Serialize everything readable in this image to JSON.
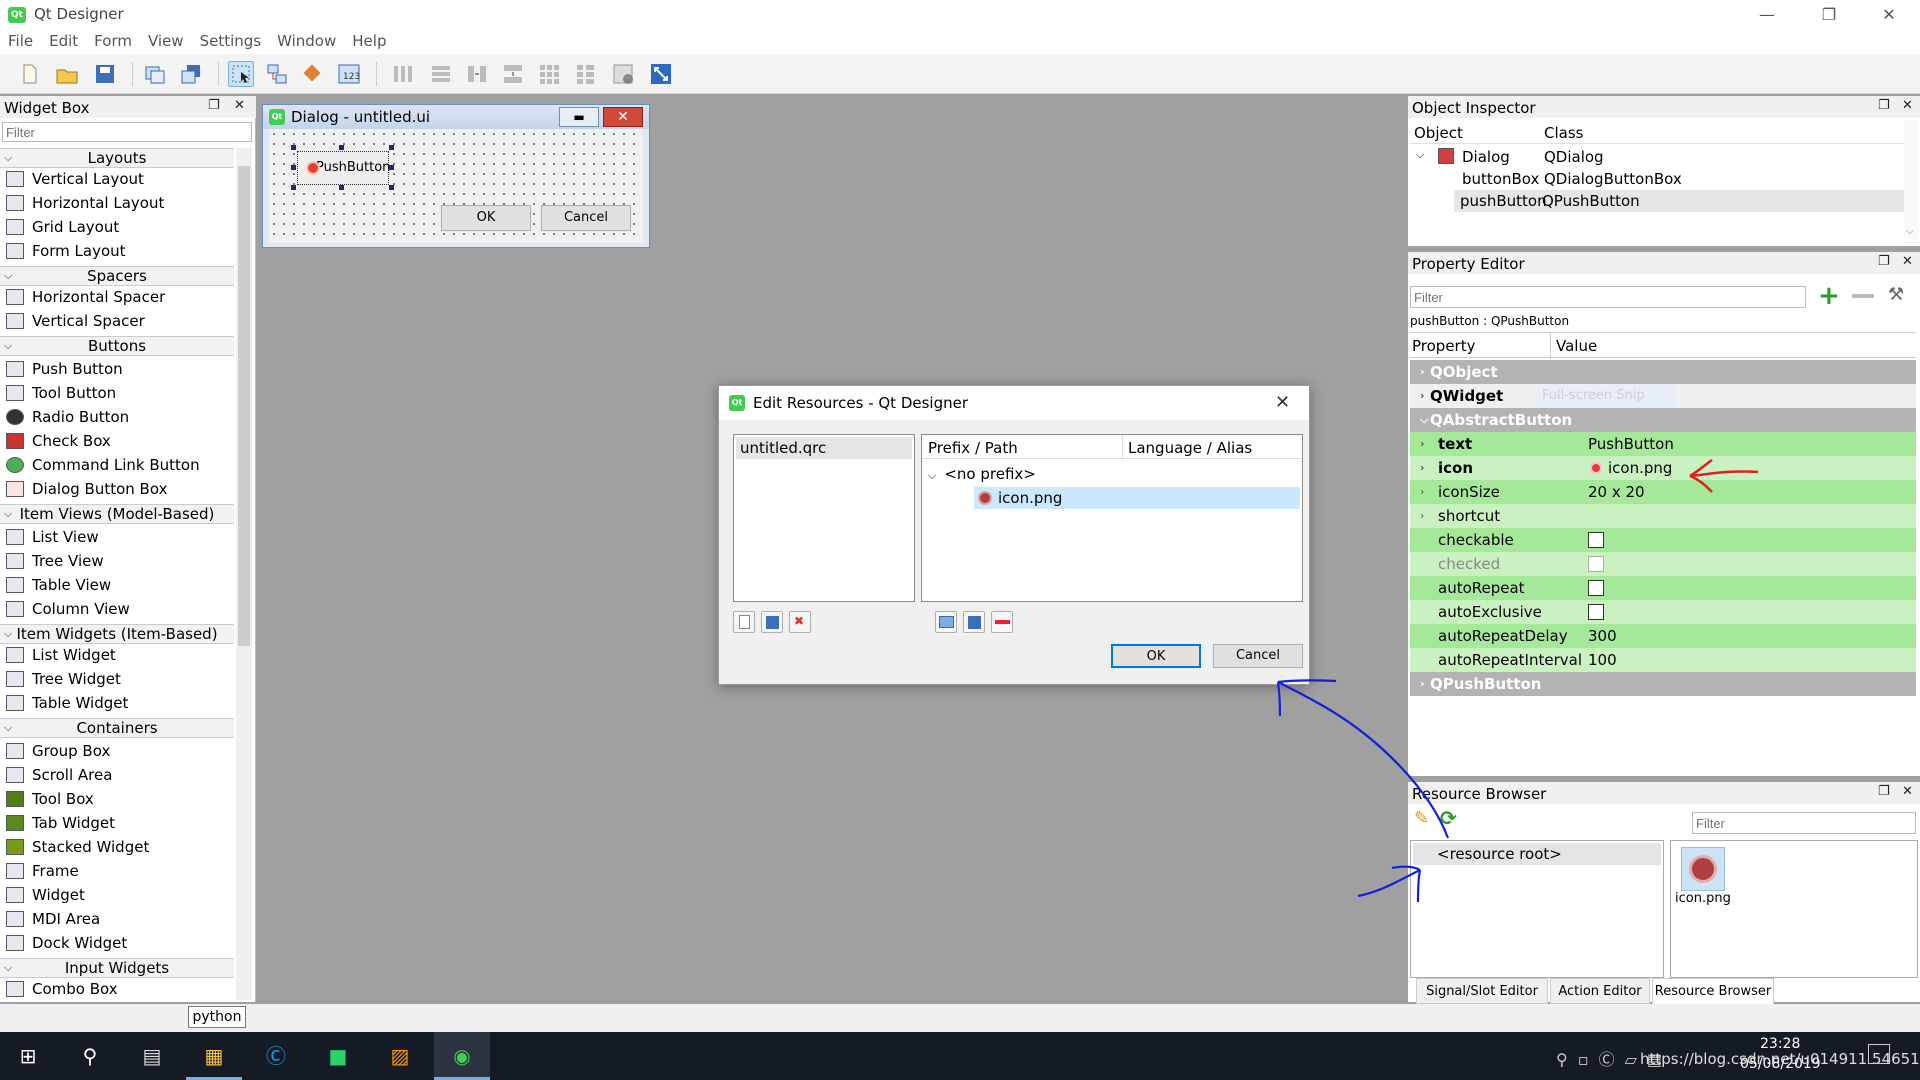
{
  "window": {
    "title": "Qt Designer",
    "app_icon_label": "Qt"
  },
  "menu": [
    "File",
    "Edit",
    "Form",
    "View",
    "Settings",
    "Window",
    "Help"
  ],
  "widget_box": {
    "title": "Widget Box",
    "filter_placeholder": "Filter",
    "categories": {
      "layouts": "Layouts",
      "spacers": "Spacers",
      "buttons": "Buttons",
      "item_views": "Item Views (Model-Based)",
      "item_widgets": "Item Widgets (Item-Based)",
      "containers": "Containers",
      "input_widgets": "Input Widgets"
    },
    "items": {
      "vertical_layout": "Vertical Layout",
      "horizontal_layout": "Horizontal Layout",
      "grid_layout": "Grid Layout",
      "form_layout": "Form Layout",
      "horizontal_spacer": "Horizontal Spacer",
      "vertical_spacer": "Vertical Spacer",
      "push_button": "Push Button",
      "tool_button": "Tool Button",
      "radio_button": "Radio Button",
      "check_box": "Check Box",
      "command_link_button": "Command Link Button",
      "dialog_button_box": "Dialog Button Box",
      "list_view": "List View",
      "tree_view": "Tree View",
      "table_view": "Table View",
      "column_view": "Column View",
      "list_widget": "List Widget",
      "tree_widget": "Tree Widget",
      "table_widget": "Table Widget",
      "group_box": "Group Box",
      "scroll_area": "Scroll Area",
      "tool_box": "Tool Box",
      "tab_widget": "Tab Widget",
      "stacked_widget": "Stacked Widget",
      "frame": "Frame",
      "widget": "Widget",
      "mdi_area": "MDI Area",
      "dock_widget": "Dock Widget",
      "combo_box": "Combo Box"
    }
  },
  "form_dialog": {
    "title": "Dialog - untitled.ui",
    "push_button": "PushButton",
    "ok": "OK",
    "cancel": "Cancel"
  },
  "edit_resources": {
    "title": "Edit Resources - Qt Designer",
    "file": "untitled.qrc",
    "col_prefix": "Prefix / Path",
    "col_lang": "Language / Alias",
    "no_prefix": "<no prefix>",
    "icon_file": "icon.png",
    "ok": "OK",
    "cancel": "Cancel"
  },
  "object_inspector": {
    "title": "Object Inspector",
    "col_object": "Object",
    "col_class": "Class",
    "rows": [
      {
        "object": "Dialog",
        "class": "QDialog"
      },
      {
        "object": "buttonBox",
        "class": "QDialogButtonBox"
      },
      {
        "object": "pushButton",
        "class": "QPushButton"
      }
    ]
  },
  "property_editor": {
    "title": "Property Editor",
    "filter_placeholder": "Filter",
    "object_label": "pushButton : QPushButton",
    "col_property": "Property",
    "col_value": "Value",
    "groups": {
      "qobject": "QObject",
      "qwidget": "QWidget",
      "qabstractbutton": "QAbstractButton",
      "qpushbutton": "QPushButton"
    },
    "ghost_text": "Full-screen Snip",
    "props": {
      "text": {
        "name": "text",
        "value": "PushButton"
      },
      "icon": {
        "name": "icon",
        "value": "icon.png"
      },
      "iconsize": {
        "name": "iconSize",
        "value": "20 x 20"
      },
      "shortcut": {
        "name": "shortcut",
        "value": ""
      },
      "checkable": {
        "name": "checkable"
      },
      "checked": {
        "name": "checked"
      },
      "autorepeat": {
        "name": "autoRepeat"
      },
      "autoexclusive": {
        "name": "autoExclusive"
      },
      "autorepeatdelay": {
        "name": "autoRepeatDelay",
        "value": "300"
      },
      "autorepeatinterval": {
        "name": "autoRepeatInterval",
        "value": "100"
      }
    }
  },
  "resource_browser": {
    "title": "Resource Browser",
    "filter_placeholder": "Filter",
    "root": "<resource root>",
    "icon_label": "icon.png"
  },
  "bottom_tabs": [
    "Signal/Slot Editor",
    "Action Editor",
    "Resource Browser"
  ],
  "tooltip": "python",
  "taskbar": {
    "time": "23:28",
    "date": "05/08/2019",
    "watermark": "https://blog.csdn.net/u014911 54651"
  },
  "colors": {
    "accent": "#0078d7",
    "property_group": "#b3b3b3",
    "property_green": "#c9f2c0",
    "annotation_red": "#e0201c",
    "annotation_blue": "#1420d8"
  }
}
